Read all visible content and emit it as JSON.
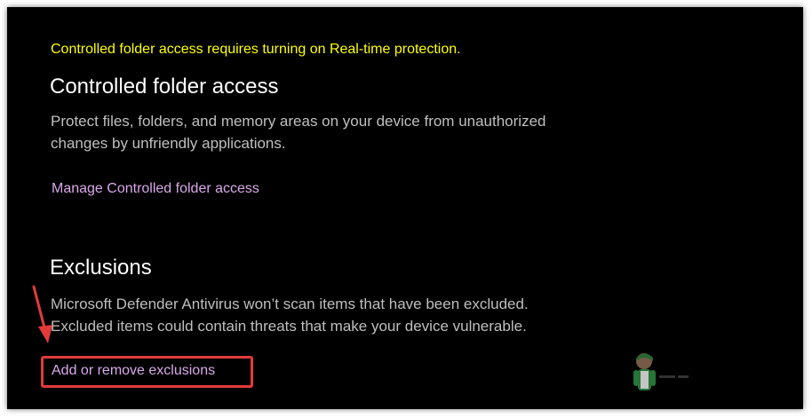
{
  "colors": {
    "background": "#000000",
    "warning_text": "#ffff00",
    "heading_text": "#ffffff",
    "body_text": "#bfbfbf",
    "link_text": "#d9a8ea",
    "annotation_red": "#e33a3a"
  },
  "warning": {
    "text": "Controlled folder access requires turning on Real-time protection."
  },
  "controlled_folder_access": {
    "title": "Controlled folder access",
    "description_line1": "Protect files, folders, and memory areas on your device from unauthorized",
    "description_line2": "changes by unfriendly applications.",
    "link": "Manage Controlled folder access"
  },
  "exclusions": {
    "title": "Exclusions",
    "description_line1": "Microsoft Defender Antivirus won’t scan items that have been excluded.",
    "description_line2": "Excluded items could contain threats that make your device vulnerable.",
    "link": "Add or remove exclusions"
  },
  "annotations": {
    "arrow_icon": "red-arrow-icon",
    "highlight": "red-highlight-box",
    "watermark_icon": "watermark-logo-icon"
  }
}
